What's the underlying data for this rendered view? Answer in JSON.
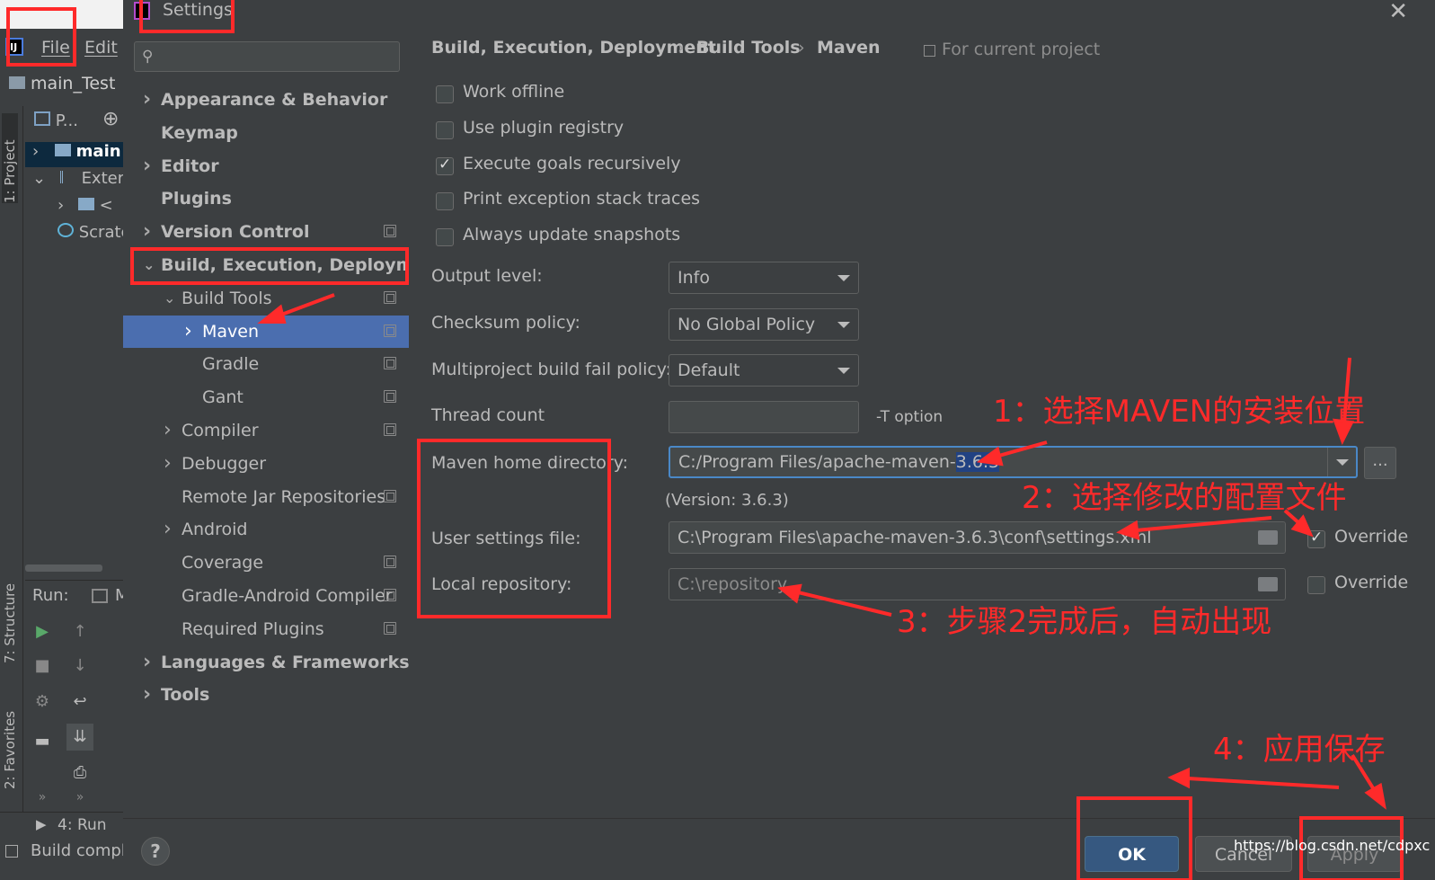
{
  "ide": {
    "menu": {
      "file": "File",
      "edit": "Edit"
    },
    "project_title": "main_Test",
    "side_tabs": {
      "project": "1: Project",
      "structure": "7: Structure",
      "favorites": "2: Favorites"
    },
    "tree": {
      "toolbar_label": "P...",
      "main": "main",
      "external": "Exterr",
      "angle": "<",
      "scratches": "Scratc"
    },
    "run_label": "Run:",
    "run_tab_partial": "M",
    "run_bottom": "4: Run",
    "status": "Build compl"
  },
  "settings": {
    "title": "Settings",
    "search": {
      "placeholder": "",
      "value": ""
    },
    "tree": [
      {
        "label": "Appearance & Behavior",
        "bold": true,
        "chevron": "right",
        "copy": false
      },
      {
        "label": "Keymap",
        "bold": true,
        "chevron": "",
        "copy": false
      },
      {
        "label": "Editor",
        "bold": true,
        "chevron": "right",
        "copy": false
      },
      {
        "label": "Plugins",
        "bold": true,
        "chevron": "",
        "copy": false
      },
      {
        "label": "Version Control",
        "bold": true,
        "chevron": "right",
        "copy": true
      },
      {
        "label": "Build, Execution, Deployment",
        "bold": true,
        "chevron": "down",
        "copy": false
      },
      {
        "label": "Build Tools",
        "bold": false,
        "chevron": "down",
        "copy": true
      },
      {
        "label": "Maven",
        "bold": false,
        "chevron": "right",
        "copy": true,
        "selected": true
      },
      {
        "label": "Gradle",
        "bold": false,
        "chevron": "",
        "copy": true
      },
      {
        "label": "Gant",
        "bold": false,
        "chevron": "",
        "copy": true
      },
      {
        "label": "Compiler",
        "bold": false,
        "chevron": "right",
        "copy": true
      },
      {
        "label": "Debugger",
        "bold": false,
        "chevron": "right",
        "copy": false
      },
      {
        "label": "Remote Jar Repositories",
        "bold": false,
        "chevron": "",
        "copy": true
      },
      {
        "label": "Android",
        "bold": false,
        "chevron": "right",
        "copy": false
      },
      {
        "label": "Coverage",
        "bold": false,
        "chevron": "",
        "copy": true
      },
      {
        "label": "Gradle-Android Compiler",
        "bold": false,
        "chevron": "",
        "copy": true
      },
      {
        "label": "Required Plugins",
        "bold": false,
        "chevron": "",
        "copy": true
      },
      {
        "label": "Languages & Frameworks",
        "bold": true,
        "chevron": "right",
        "copy": false
      },
      {
        "label": "Tools",
        "bold": true,
        "chevron": "right",
        "copy": false
      }
    ],
    "breadcrumb": {
      "part1": "Build, Execution, Deployment",
      "part2": "Build Tools",
      "part3": "Maven",
      "sep": "›",
      "scope": "For current project"
    },
    "checkboxes": {
      "work_offline": {
        "label": "Work offline",
        "checked": false
      },
      "use_plugin_registry": {
        "label": "Use plugin registry",
        "checked": false
      },
      "execute_goals": {
        "label": "Execute goals recursively",
        "checked": true
      },
      "print_exception": {
        "label": "Print exception stack traces",
        "checked": false
      },
      "always_update": {
        "label": "Always update snapshots",
        "checked": false
      }
    },
    "fields": {
      "output_level": {
        "label": "Output level:",
        "value": "Info"
      },
      "checksum_policy": {
        "label": "Checksum policy:",
        "value": "No Global Policy"
      },
      "multiproject_policy": {
        "label": "Multiproject build fail policy:",
        "value": "Default"
      },
      "thread_count": {
        "label": "Thread count",
        "value": "",
        "suffix": "-T option"
      },
      "maven_home": {
        "label": "Maven home directory:",
        "value_prefix": "C:/Program Files/apache-maven-",
        "value_selected": "3.6.3",
        "browse": "..."
      },
      "version": "(Version: 3.6.3)",
      "user_settings": {
        "label": "User settings file:",
        "value": "C:\\Program Files\\apache-maven-3.6.3\\conf\\settings.xml",
        "override_label": "Override",
        "override_checked": true
      },
      "local_repo": {
        "label": "Local repository:",
        "value": "C:\\repository",
        "override_label": "Override",
        "override_checked": false
      }
    },
    "buttons": {
      "ok": "OK",
      "cancel": "Cancel",
      "apply": "Apply",
      "help": "?"
    }
  },
  "annotations": {
    "note1": "1：选择MAVEN的安装位置",
    "note2": "2：选择修改的配置文件",
    "note3": "3：步骤2完成后，自动出现",
    "note4": "4：应用保存",
    "color": "#ff2a2a"
  },
  "watermark": "https://blog.csdn.net/cdpxc"
}
